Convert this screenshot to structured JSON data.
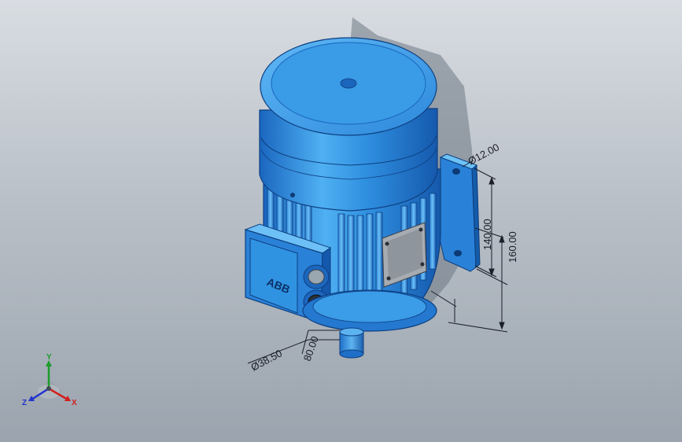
{
  "viewport": {
    "name": "3D model viewport",
    "model": "electric motor"
  },
  "nameplate_logo": "ABB",
  "dimensions": {
    "d1": "Ø12.00",
    "d2": "140.00",
    "d3": "160.00",
    "d4": "Ø38.50",
    "d5": "80.00"
  },
  "triad": {
    "x_label": "X",
    "y_label": "Y",
    "z_label": "Z",
    "x_color": "#d21e1e",
    "y_color": "#1e9b2a",
    "z_color": "#2233cc"
  },
  "colors": {
    "motor_blue": "#2e8fe0",
    "motor_dark": "#1257a8",
    "motor_light": "#7cc4f5",
    "background_top": "#d9dde2",
    "background_bottom": "#9ba4ae"
  }
}
